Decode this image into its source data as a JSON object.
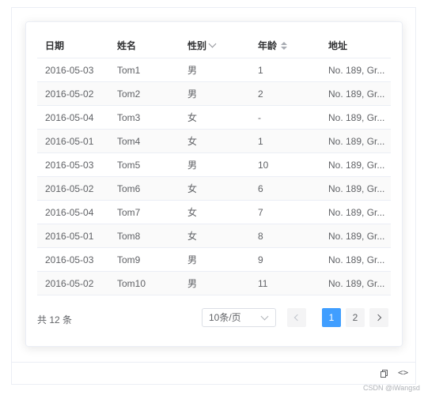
{
  "table": {
    "headers": {
      "date": "日期",
      "name": "姓名",
      "sex": "性别",
      "age": "年龄",
      "address": "地址"
    },
    "rows": [
      {
        "date": "2016-05-03",
        "name": "Tom1",
        "sex": "男",
        "age": "1",
        "address": "No. 189, Gr..."
      },
      {
        "date": "2016-05-02",
        "name": "Tom2",
        "sex": "男",
        "age": "2",
        "address": "No. 189, Gr..."
      },
      {
        "date": "2016-05-04",
        "name": "Tom3",
        "sex": "女",
        "age": "-",
        "address": "No. 189, Gr..."
      },
      {
        "date": "2016-05-01",
        "name": "Tom4",
        "sex": "女",
        "age": "1",
        "address": "No. 189, Gr..."
      },
      {
        "date": "2016-05-03",
        "name": "Tom5",
        "sex": "男",
        "age": "10",
        "address": "No. 189, Gr..."
      },
      {
        "date": "2016-05-02",
        "name": "Tom6",
        "sex": "女",
        "age": "6",
        "address": "No. 189, Gr..."
      },
      {
        "date": "2016-05-04",
        "name": "Tom7",
        "sex": "女",
        "age": "7",
        "address": "No. 189, Gr..."
      },
      {
        "date": "2016-05-01",
        "name": "Tom8",
        "sex": "女",
        "age": "8",
        "address": "No. 189, Gr..."
      },
      {
        "date": "2016-05-03",
        "name": "Tom9",
        "sex": "男",
        "age": "9",
        "address": "No. 189, Gr..."
      },
      {
        "date": "2016-05-02",
        "name": "Tom10",
        "sex": "男",
        "age": "11",
        "address": "No. 189, Gr..."
      }
    ]
  },
  "pagination": {
    "total_text": "共 12 条",
    "page_size": "10条/页",
    "pages": [
      "1",
      "2"
    ],
    "current_page": "1"
  },
  "footer": {
    "watermark": "CSDN @iWangsd"
  },
  "icons": {
    "sex_filter": "chevron-down-icon",
    "age_sort": "sort-caret-icon",
    "copy": "copy-icon",
    "code": "code-icon"
  },
  "colors": {
    "primary": "#409eff",
    "stripe": "#fafafa",
    "border": "#ebeef5"
  }
}
